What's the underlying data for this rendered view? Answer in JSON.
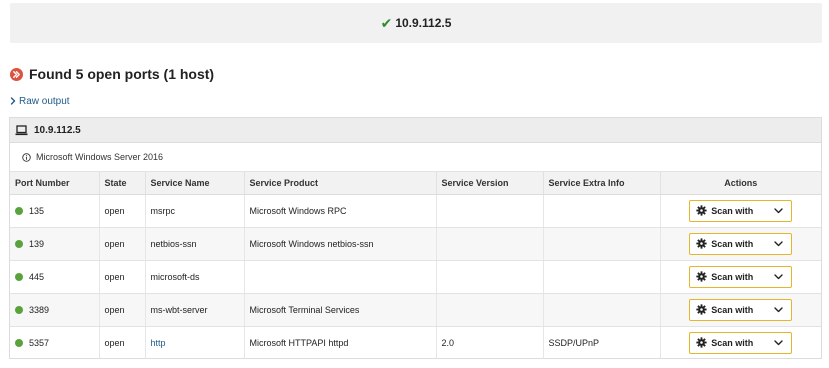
{
  "host_banner": {
    "status_icon": "check-icon",
    "ip": "10.9.112.5"
  },
  "summary": {
    "title": "Found 5 open ports (1 host)",
    "status_color": "#d9533f"
  },
  "raw_output": {
    "label": "Raw output"
  },
  "host_panel": {
    "ip": "10.9.112.5",
    "os": "Microsoft Windows Server 2016",
    "columns": [
      "Port Number",
      "State",
      "Service Name",
      "Service Product",
      "Service Version",
      "Service Extra Info",
      "Actions"
    ],
    "rows": [
      {
        "port": "135",
        "state": "open",
        "service_name": "msrpc",
        "service_product": "Microsoft Windows RPC",
        "service_version": "",
        "extra_info": "",
        "action": "Scan with"
      },
      {
        "port": "139",
        "state": "open",
        "service_name": "netbios-ssn",
        "service_product": "Microsoft Windows netbios-ssn",
        "service_version": "",
        "extra_info": "",
        "action": "Scan with"
      },
      {
        "port": "445",
        "state": "open",
        "service_name": "microsoft-ds",
        "service_product": "",
        "service_version": "",
        "extra_info": "",
        "action": "Scan with"
      },
      {
        "port": "3389",
        "state": "open",
        "service_name": "ms-wbt-server",
        "service_product": "Microsoft Terminal Services",
        "service_version": "",
        "extra_info": "",
        "action": "Scan with"
      },
      {
        "port": "5357",
        "state": "open",
        "service_name": "http",
        "service_product": "Microsoft HTTPAPI httpd",
        "service_version": "2.0",
        "extra_info": "SSDP/UPnP",
        "action": "Scan with"
      }
    ]
  },
  "colors": {
    "open_status": "#5aa33c",
    "link": "#1f5a8a",
    "button_border": "#e3b72c",
    "check": "#2e8b2e"
  }
}
